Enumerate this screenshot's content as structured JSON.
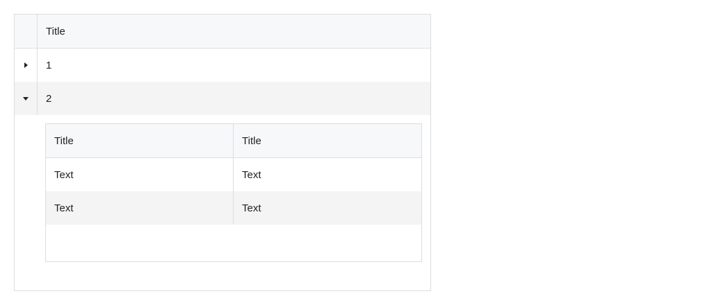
{
  "grid": {
    "header": {
      "title": "Title"
    },
    "rows": [
      {
        "label": "1",
        "expanded": false
      },
      {
        "label": "2",
        "expanded": true
      }
    ]
  },
  "detail_table": {
    "headers": [
      "Title",
      "Title"
    ],
    "rows": [
      [
        "Text",
        "Text"
      ],
      [
        "Text",
        "Text"
      ]
    ]
  },
  "colors": {
    "header_bg": "#f7f8fa",
    "alt_row_bg": "#f4f4f4",
    "border": "#dcdde0"
  },
  "icons": {
    "collapsed": "caret-right-icon",
    "expanded": "caret-down-icon"
  }
}
